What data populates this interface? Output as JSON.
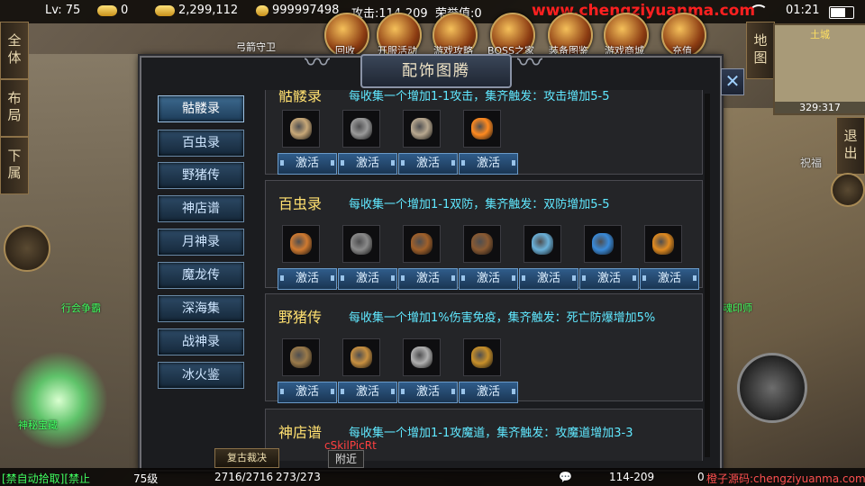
{
  "topbar": {
    "level": "Lv:  75",
    "gold_bars": "0",
    "gold": "2,299,112",
    "yuanbao": "999997498",
    "attack": "攻击:114-209",
    "contribution": "荣誉值:0",
    "watermark": "www.chengziyuanma.com",
    "time": "01:21"
  },
  "activities": [
    {
      "label": "回收"
    },
    {
      "label": "开服活动"
    },
    {
      "label": "游戏攻略"
    },
    {
      "label": "BOSS之家"
    },
    {
      "label": "装备图鉴"
    },
    {
      "label": "游戏商城"
    },
    {
      "label": "充值"
    }
  ],
  "npc_labels": {
    "guard": "弓箭守卫",
    "guild": "行会争霸",
    "treasure": "神秘宝藏",
    "soul": "魂印师",
    "bless": "祝福"
  },
  "left_tabs": [
    "全体",
    "布局",
    "下属"
  ],
  "right_tabs": {
    "map": "地图",
    "exit": "退出"
  },
  "minimap": {
    "title": "土城",
    "coords": "329:317"
  },
  "panel": {
    "title": "配饰图腾",
    "close": "✕"
  },
  "categories": [
    "骷髅录",
    "百虫录",
    "野猪传",
    "神店谱",
    "月神录",
    "魔龙传",
    "深海集",
    "战神录",
    "冰火鉴"
  ],
  "sections": [
    {
      "name": "骷髅录",
      "desc": "每收集一个增加1-1攻击，集齐触发：攻击增加5-5",
      "items": [
        {
          "icon": "skull-icon",
          "color": "#c8a878",
          "button": "激活"
        },
        {
          "icon": "skeleton-icon",
          "color": "#9a9a9a",
          "button": "激活"
        },
        {
          "icon": "bald-head-icon",
          "color": "#b8a890",
          "button": "激活"
        },
        {
          "icon": "fireball-icon",
          "color": "#ff8a20",
          "button": "激活"
        }
      ]
    },
    {
      "name": "百虫录",
      "desc": "每收集一个增加1-1双防，集齐触发：双防增加5-5",
      "items": [
        {
          "icon": "amulet-icon",
          "color": "#d07a30",
          "button": "激活"
        },
        {
          "icon": "bug-claw-icon",
          "color": "#8a8a8a",
          "button": "激活"
        },
        {
          "icon": "horn-ring-icon",
          "color": "#a0602a",
          "button": "激活"
        },
        {
          "icon": "beetle-shell-icon",
          "color": "#8a5a32",
          "button": "激活"
        },
        {
          "icon": "crystal-bug-icon",
          "color": "#6ab0d8",
          "button": "激活"
        },
        {
          "icon": "wing-icon",
          "color": "#3a8ad8",
          "button": "激活"
        },
        {
          "icon": "amber-gem-icon",
          "color": "#e08a20",
          "button": "激活"
        }
      ]
    },
    {
      "name": "野猪传",
      "desc": "每收集一个增加1%伤害免疫，集齐触发：死亡防爆增加5%",
      "items": [
        {
          "icon": "tusk-icon",
          "color": "#9a7a4a",
          "button": "激活"
        },
        {
          "icon": "bone-spike-icon",
          "color": "#c89040",
          "button": "激活"
        },
        {
          "icon": "crossed-tusks-icon",
          "color": "#b0b0b0",
          "button": "激活"
        },
        {
          "icon": "boar-head-icon",
          "color": "#c8902a",
          "button": "激活"
        }
      ]
    },
    {
      "name": "神店谱",
      "desc": "每收集一个增加1-1攻魔道，集齐触发：攻魔道增加3-3",
      "items": []
    }
  ],
  "bottom": {
    "pickup": "[禁自动拾取][禁止",
    "level": "75级",
    "hp": "2716/2716",
    "mp": "273/273",
    "restore": "复古裁决",
    "chat_name": "cSkilPicRt",
    "nearby": "附近",
    "coords": "114-209",
    "zero": "0",
    "source": "橙子源码:chengziyuanma.com"
  }
}
